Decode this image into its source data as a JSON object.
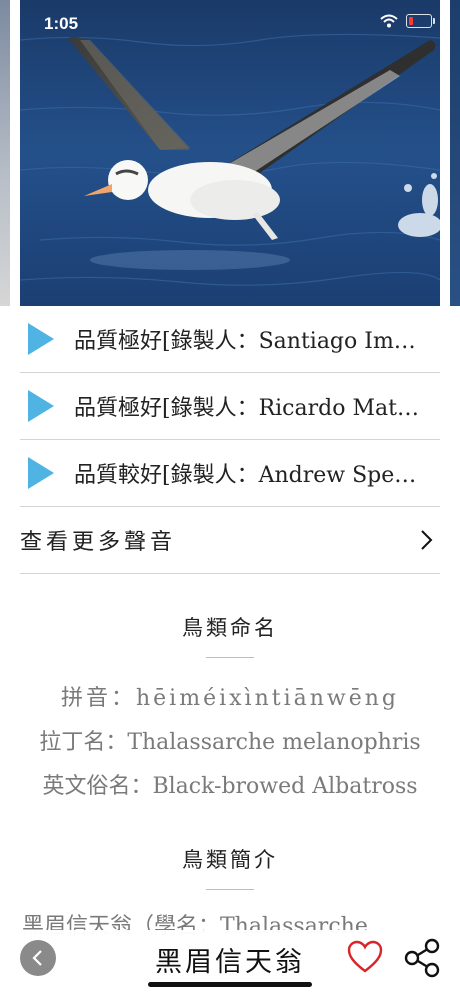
{
  "status_bar": {
    "time": "1:05"
  },
  "sounds": [
    {
      "label": "品質極好[錄製人：Santiago Im…"
    },
    {
      "label": "品質極好[錄製人：Ricardo  Mat…"
    },
    {
      "label": "品質較好[錄製人：Andrew Spe…"
    }
  ],
  "more_sounds_label": "查看更多聲音",
  "naming": {
    "title": "鳥類命名",
    "pinyin": "拼音：hēiméixìntiānwēng",
    "latin": "拉丁名：Thalassarche melanophris",
    "english": "英文俗名：Black-browed Albatross"
  },
  "intro": {
    "title": "鳥類簡介",
    "text": "黑眉信天翁（學名：Thalassarche"
  },
  "bottom_bar": {
    "title": "黑眉信天翁"
  },
  "colors": {
    "play": "#4fb3e3",
    "heart": "#d9252a",
    "back_bg": "#8a8a8a"
  },
  "icons": [
    "play-icon",
    "chevron-right-icon",
    "back-arrow-icon",
    "heart-icon",
    "share-icon",
    "wifi-icon",
    "battery-icon"
  ]
}
